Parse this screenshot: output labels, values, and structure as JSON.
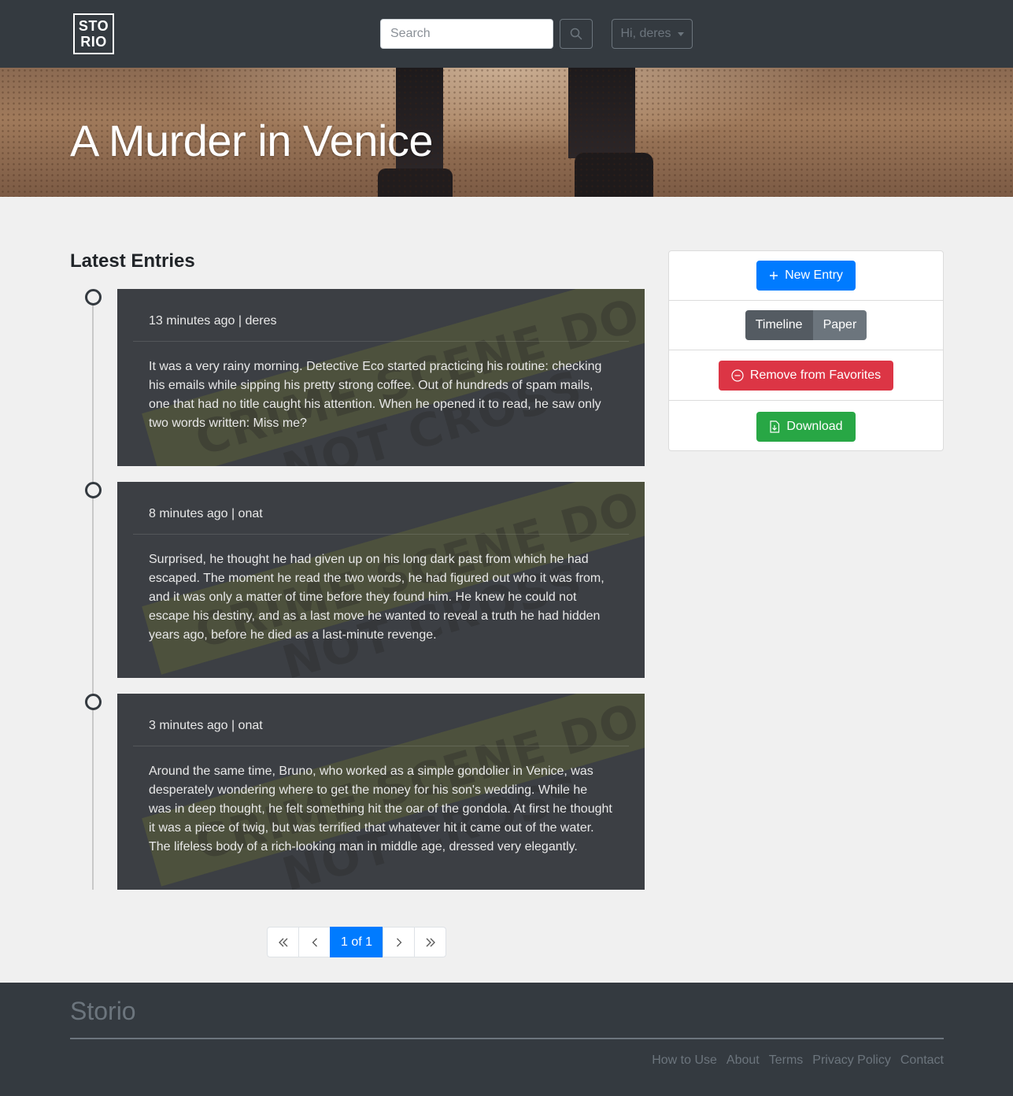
{
  "navbar": {
    "logo_line1": "STO",
    "logo_line2": "RIO",
    "search_placeholder": "Search",
    "user_label": "Hi, deres"
  },
  "hero": {
    "title": "A Murder in Venice"
  },
  "main": {
    "section_title": "Latest Entries",
    "entries": [
      {
        "meta": "13 minutes ago | deres",
        "body": "It was a very rainy morning. Detective Eco started practicing his routine: checking his emails while sipping his pretty strong coffee. Out of hundreds of spam mails, one that had no title caught his attention. When he opened it to read, he saw only two words written: Miss me?"
      },
      {
        "meta": "8 minutes ago | onat",
        "body": "Surprised, he thought he had given up on his long dark past from which he had escaped. The moment he read the two words, he had figured out who it was from, and it was only a matter of time before they found him. He knew he could not escape his destiny, and as a last move he wanted to reveal a truth he had hidden years ago, before he died as a last-minute revenge."
      },
      {
        "meta": "3 minutes ago | onat",
        "body": "Around the same time, Bruno, who worked as a simple gondolier in Venice, was desperately wondering where to get the money for his son's wedding. While he was in deep thought, he felt something hit the oar of the gondola. At first he thought it was a piece of twig, but was terrified that whatever hit it came out of the water. The lifeless body of a rich-looking man in middle age, dressed very elegantly."
      }
    ],
    "pagination": {
      "current": "1 of 1"
    }
  },
  "sidebar": {
    "new_entry_label": "New Entry",
    "view_timeline_label": "Timeline",
    "view_paper_label": "Paper",
    "remove_favorites_label": "Remove from Favorites",
    "download_label": "Download"
  },
  "footer": {
    "brand": "Storio",
    "links": [
      "How to Use",
      "About",
      "Terms",
      "Privacy Policy",
      "Contact"
    ]
  },
  "colors": {
    "navbar_bg": "#343a40",
    "primary": "#007bff",
    "danger": "#dc3545",
    "success": "#28a745",
    "card_bg": "#3c3f44"
  }
}
